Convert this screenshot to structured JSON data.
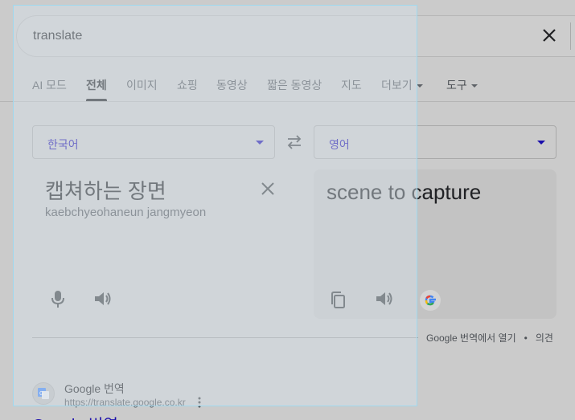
{
  "search": {
    "query": "translate",
    "clear_icon": "close-icon"
  },
  "tabs": [
    {
      "label": "AI 모드"
    },
    {
      "label": "전체",
      "active": true
    },
    {
      "label": "이미지"
    },
    {
      "label": "쇼핑"
    },
    {
      "label": "동영상"
    },
    {
      "label": "짧은 동영상"
    },
    {
      "label": "지도"
    },
    {
      "label": "더보기",
      "has_dropdown": true
    },
    {
      "label": "도구",
      "has_dropdown": true
    }
  ],
  "translator": {
    "source_lang": "한국어",
    "target_lang": "영어",
    "source_text": "캡쳐하는 장면",
    "source_romanization": "kaebchyeohaneun jangmyeon",
    "target_text": "scene to capture",
    "footer_open": "Google 번역에서 열기",
    "footer_separator": "•",
    "footer_feedback": "의견"
  },
  "result": {
    "site_name": "Google 번역",
    "url": "https://translate.google.co.kr",
    "title": "Google 번역"
  },
  "colors": {
    "link": "#1a0dab",
    "background": "#cbcbcb",
    "selection_border": "#9fd8ee"
  }
}
